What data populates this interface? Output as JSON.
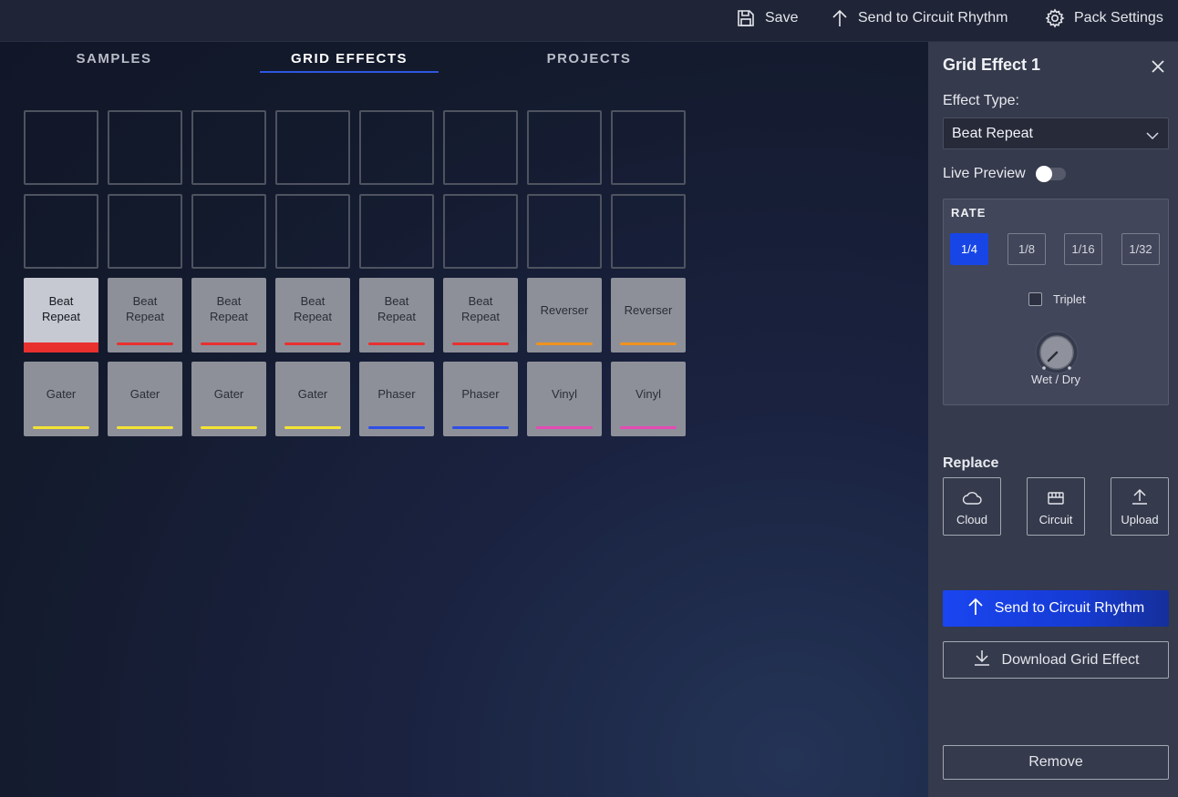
{
  "topbar": {
    "save_label": "Save",
    "send_label": "Send to Circuit Rhythm",
    "pack_settings_label": "Pack Settings"
  },
  "tabs": [
    {
      "label": "SAMPLES",
      "active": false
    },
    {
      "label": "GRID EFFECTS",
      "active": true
    },
    {
      "label": "PROJECTS",
      "active": false
    }
  ],
  "pads": {
    "empty_rows": 2,
    "columns": 8,
    "filled_rows": [
      [
        {
          "line1": "Beat",
          "line2": "Repeat",
          "color": "#e8312f",
          "selected": true
        },
        {
          "line1": "Beat",
          "line2": "Repeat",
          "color": "#e8312f"
        },
        {
          "line1": "Beat",
          "line2": "Repeat",
          "color": "#e8312f"
        },
        {
          "line1": "Beat",
          "line2": "Repeat",
          "color": "#e8312f"
        },
        {
          "line1": "Beat",
          "line2": "Repeat",
          "color": "#e8312f"
        },
        {
          "line1": "Beat",
          "line2": "Repeat",
          "color": "#e8312f"
        },
        {
          "line1": "Reverser",
          "line2": "",
          "color": "#f0921f"
        },
        {
          "line1": "Reverser",
          "line2": "",
          "color": "#f0921f"
        }
      ],
      [
        {
          "line1": "Gater",
          "line2": "",
          "color": "#f4e332"
        },
        {
          "line1": "Gater",
          "line2": "",
          "color": "#f4e332"
        },
        {
          "line1": "Gater",
          "line2": "",
          "color": "#f4e332"
        },
        {
          "line1": "Gater",
          "line2": "",
          "color": "#f4e332"
        },
        {
          "line1": "Phaser",
          "line2": "",
          "color": "#2f4fe6"
        },
        {
          "line1": "Phaser",
          "line2": "",
          "color": "#2f4fe6"
        },
        {
          "line1": "Vinyl",
          "line2": "",
          "color": "#e64bb3"
        },
        {
          "line1": "Vinyl",
          "line2": "",
          "color": "#e64bb3"
        }
      ]
    ]
  },
  "panel": {
    "title": "Grid Effect 1",
    "effect_type_label": "Effect Type:",
    "effect_type_value": "Beat Repeat",
    "live_preview_label": "Live Preview",
    "live_preview_on": false,
    "rate": {
      "title": "RATE",
      "options": [
        "1/4",
        "1/8",
        "1/16",
        "1/32"
      ],
      "selected": "1/4",
      "triplet_label": "Triplet",
      "triplet_checked": false,
      "knob_label": "Wet / Dry"
    },
    "replace": {
      "title": "Replace",
      "cloud_label": "Cloud",
      "circuit_label": "Circuit",
      "upload_label": "Upload"
    },
    "send_button": "Send to Circuit Rhythm",
    "download_button": "Download Grid Effect",
    "remove_button": "Remove"
  },
  "colors": {
    "accent": "#1846e6",
    "tab_underline": "#2f56e0"
  }
}
